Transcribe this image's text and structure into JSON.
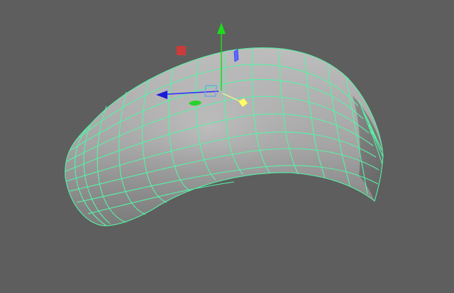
{
  "viewport": {
    "background": "#5e5e5e"
  },
  "mesh": {
    "name": "nurbs-surface",
    "wire_color": "#57f2a6",
    "shade_light": "#b8b8b8",
    "shade_mid": "#8a8a8a",
    "shade_dark": "#5a5a5a"
  },
  "manipulator": {
    "type": "move-tool-gizmo",
    "x_axis_color": "#1b1bdb",
    "y_axis_color": "#1bdb1b",
    "z_axis_color": "#1b1bdb",
    "center_handle_color": "#6fa8dc",
    "pivot_color": "#ffff66",
    "plane_handle_red": "#cc3b3b",
    "plane_handle_blue": "#5a6cff",
    "plane_handle_green": "#2ad12a"
  },
  "icons": {
    "y_arrow": "arrow-up-icon",
    "x_arrow": "arrow-left-icon",
    "pivot": "pivot-icon"
  }
}
